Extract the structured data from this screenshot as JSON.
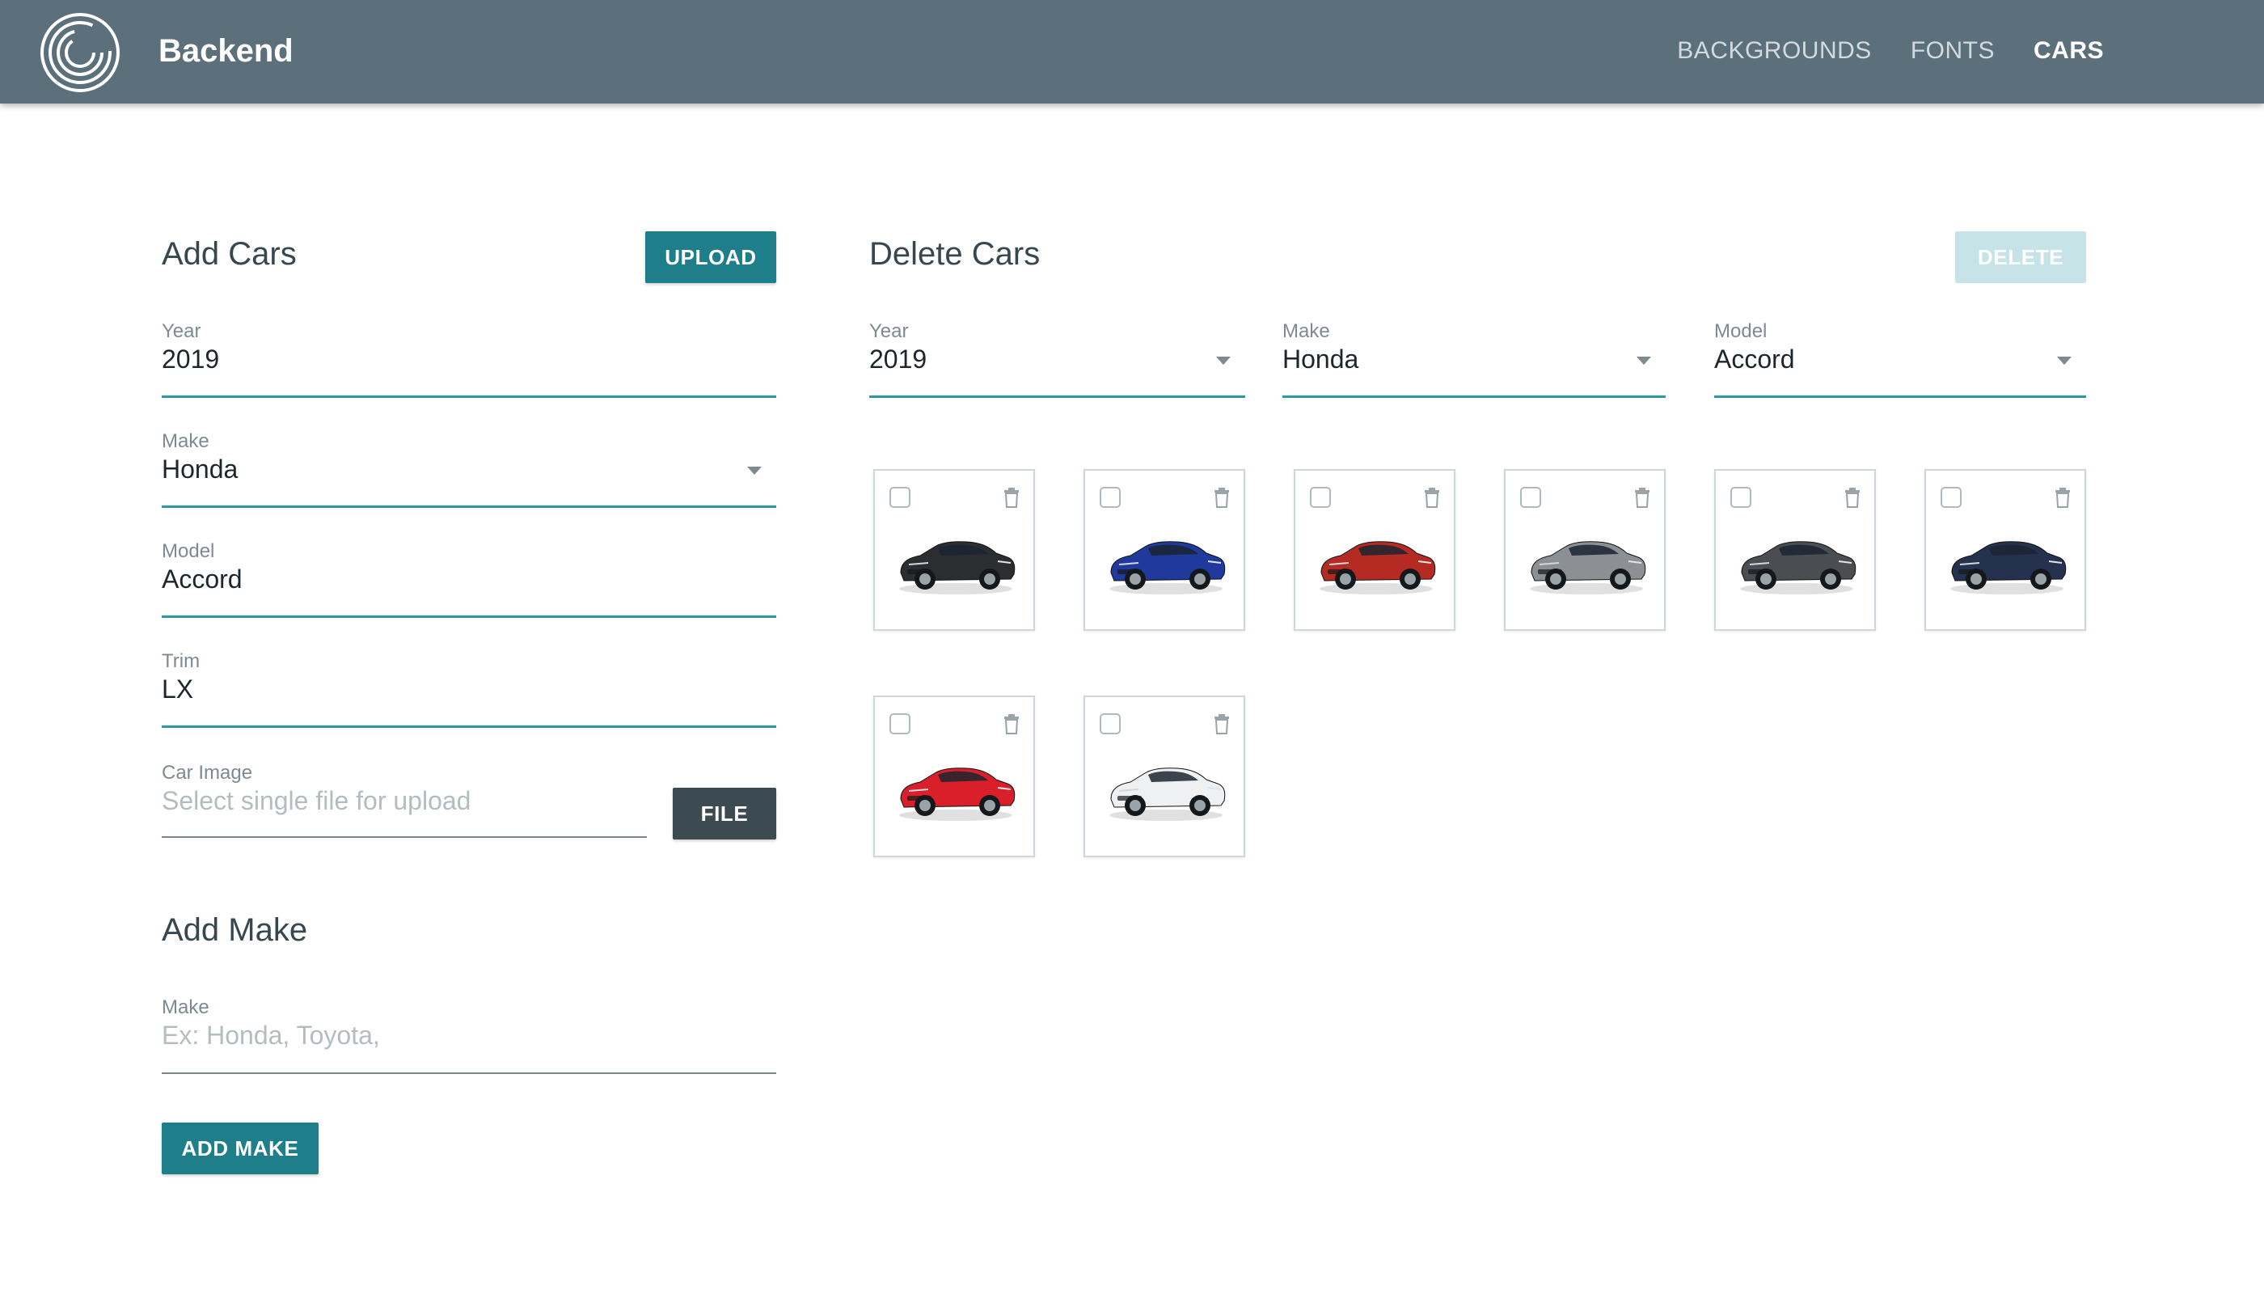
{
  "header": {
    "app_title": "Backend",
    "nav": [
      {
        "label": "BACKGROUNDS",
        "active": false
      },
      {
        "label": "FONTS",
        "active": false
      },
      {
        "label": "CARS",
        "active": true
      }
    ]
  },
  "add_cars": {
    "title": "Add Cars",
    "upload_label": "UPLOAD",
    "year": {
      "label": "Year",
      "value": "2019"
    },
    "make": {
      "label": "Make",
      "value": "Honda"
    },
    "model": {
      "label": "Model",
      "value": "Accord"
    },
    "trim": {
      "label": "Trim",
      "value": "LX"
    },
    "image": {
      "label": "Car Image",
      "placeholder": "Select single file for upload",
      "button_label": "FILE"
    }
  },
  "add_make": {
    "title": "Add Make",
    "make": {
      "label": "Make",
      "placeholder": "Ex: Honda, Toyota,"
    },
    "button_label": "ADD MAKE"
  },
  "delete_cars": {
    "title": "Delete Cars",
    "delete_label": "DELETE",
    "year": {
      "label": "Year",
      "value": "2019"
    },
    "make": {
      "label": "Make",
      "value": "Honda"
    },
    "model": {
      "label": "Model",
      "value": "Accord"
    },
    "cars": [
      {
        "color": "#2b2d30",
        "checked": false
      },
      {
        "color": "#1f3a9c",
        "checked": false
      },
      {
        "color": "#b52a22",
        "checked": false
      },
      {
        "color": "#8c8f94",
        "checked": false
      },
      {
        "color": "#4a4d52",
        "checked": false
      },
      {
        "color": "#24324f",
        "checked": false
      },
      {
        "color": "#d9202a",
        "checked": false
      },
      {
        "color": "#eef0f2",
        "checked": false
      }
    ]
  },
  "colors": {
    "header_bg": "#5c707c",
    "accent": "#1e7f8a",
    "dark_button": "#3c4a52",
    "disabled_button": "#c6e3e8"
  }
}
